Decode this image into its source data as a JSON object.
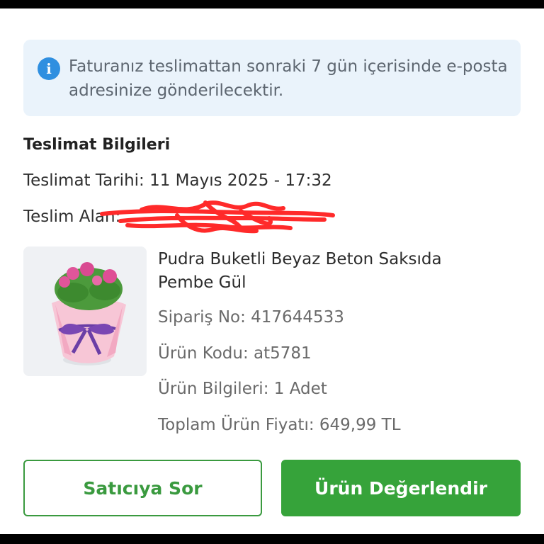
{
  "info": {
    "icon": "info-icon",
    "text": "Faturanız teslimattan sonraki 7 gün içerisinde e-posta adresinize gönderilecektir."
  },
  "delivery": {
    "title": "Teslimat Bilgileri",
    "date_line": "Teslimat Tarihi: 11 Mayıs 2025 - 17:32",
    "receiver_label": "Teslim Alan:"
  },
  "product": {
    "title": "Pudra Buketli Beyaz Beton Saksıda Pembe Gül",
    "order_no": "Sipariş No: 417644533",
    "product_code": "Ürün Kodu: at5781",
    "info": "Ürün Bilgileri: 1 Adet",
    "total_price": "Toplam Ürün Fiyatı: 649,99 TL"
  },
  "buttons": {
    "ask_seller": "Satıcıya Sor",
    "rate_product": "Ürün Değerlendir"
  },
  "colors": {
    "accent_green": "#36a33a",
    "info_blue": "#2f8fe0",
    "redaction_red": "#ff2a2a"
  }
}
